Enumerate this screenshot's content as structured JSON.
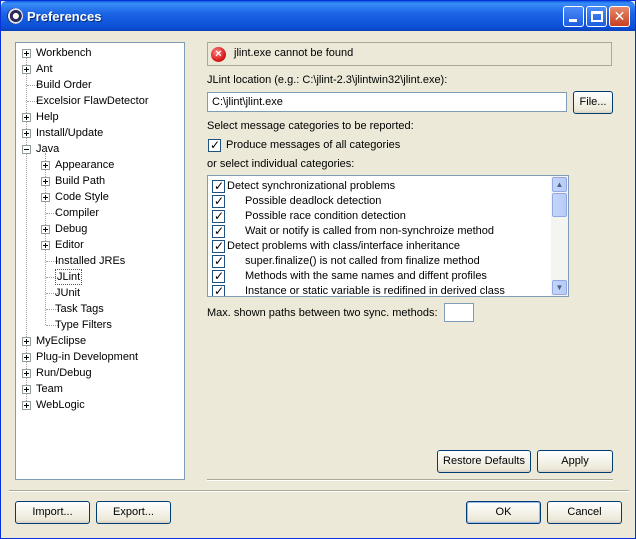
{
  "window": {
    "title": "Preferences"
  },
  "tree": {
    "items": [
      {
        "label": "Workbench",
        "expander": "plus",
        "selected": false
      },
      {
        "label": "Ant",
        "expander": "plus",
        "selected": false
      },
      {
        "label": "Build Order",
        "expander": "none",
        "selected": false
      },
      {
        "label": "Excelsior FlawDetector",
        "expander": "none",
        "selected": false
      },
      {
        "label": "Help",
        "expander": "plus",
        "selected": false
      },
      {
        "label": "Install/Update",
        "expander": "plus",
        "selected": false
      },
      {
        "label": "Java",
        "expander": "minus",
        "selected": false
      },
      {
        "label": "Appearance",
        "expander": "plus",
        "selected": false
      },
      {
        "label": "Build Path",
        "expander": "plus",
        "selected": false
      },
      {
        "label": "Code Style",
        "expander": "plus",
        "selected": false
      },
      {
        "label": "Compiler",
        "expander": "none",
        "selected": false
      },
      {
        "label": "Debug",
        "expander": "plus",
        "selected": false
      },
      {
        "label": "Editor",
        "expander": "plus",
        "selected": false
      },
      {
        "label": "Installed JREs",
        "expander": "none",
        "selected": false
      },
      {
        "label": "JLint",
        "expander": "none",
        "selected": true
      },
      {
        "label": "JUnit",
        "expander": "none",
        "selected": false
      },
      {
        "label": "Task Tags",
        "expander": "none",
        "selected": false
      },
      {
        "label": "Type Filters",
        "expander": "none",
        "selected": false
      },
      {
        "label": "MyEclipse",
        "expander": "plus",
        "selected": false
      },
      {
        "label": "Plug-in Development",
        "expander": "plus",
        "selected": false
      },
      {
        "label": "Run/Debug",
        "expander": "plus",
        "selected": false
      },
      {
        "label": "Team",
        "expander": "plus",
        "selected": false
      },
      {
        "label": "WebLogic",
        "expander": "plus",
        "selected": false
      }
    ]
  },
  "error": {
    "message": "jlint.exe cannot be found",
    "icon": "error-icon"
  },
  "jlint": {
    "location_label": "JLint location (e.g.: C:\\jlint-2.3\\jlintwin32\\jlint.exe):",
    "location_value": "C:\\jlint\\jlint.exe",
    "file_button": "File..."
  },
  "categories": {
    "select_label": "Select message categories to be reported:",
    "all_checkbox_label": "Produce messages of all categories",
    "all_checked": true,
    "individual_label": "or select individual categories:",
    "items": [
      {
        "label": "Detect synchronizational problems",
        "checked": true
      },
      {
        "label": "Possible deadlock detection",
        "checked": true
      },
      {
        "label": "Possible race condition detection",
        "checked": true
      },
      {
        "label": "Wait or notify is called from non-synchroize method",
        "checked": true
      },
      {
        "label": "Detect problems with class/interface inheritance",
        "checked": true
      },
      {
        "label": "super.finalize() is not called from finalize method",
        "checked": true
      },
      {
        "label": "Methods with the same names and diffent profiles",
        "checked": true
      },
      {
        "label": "Instance or static variable is redifined in derived class",
        "checked": true
      }
    ]
  },
  "max_paths": {
    "label": "Max. shown paths between two sync. methods:",
    "value": ""
  },
  "buttons": {
    "restore_defaults": "Restore Defaults",
    "apply": "Apply",
    "import": "Import...",
    "export": "Export...",
    "ok": "OK",
    "cancel": "Cancel"
  }
}
